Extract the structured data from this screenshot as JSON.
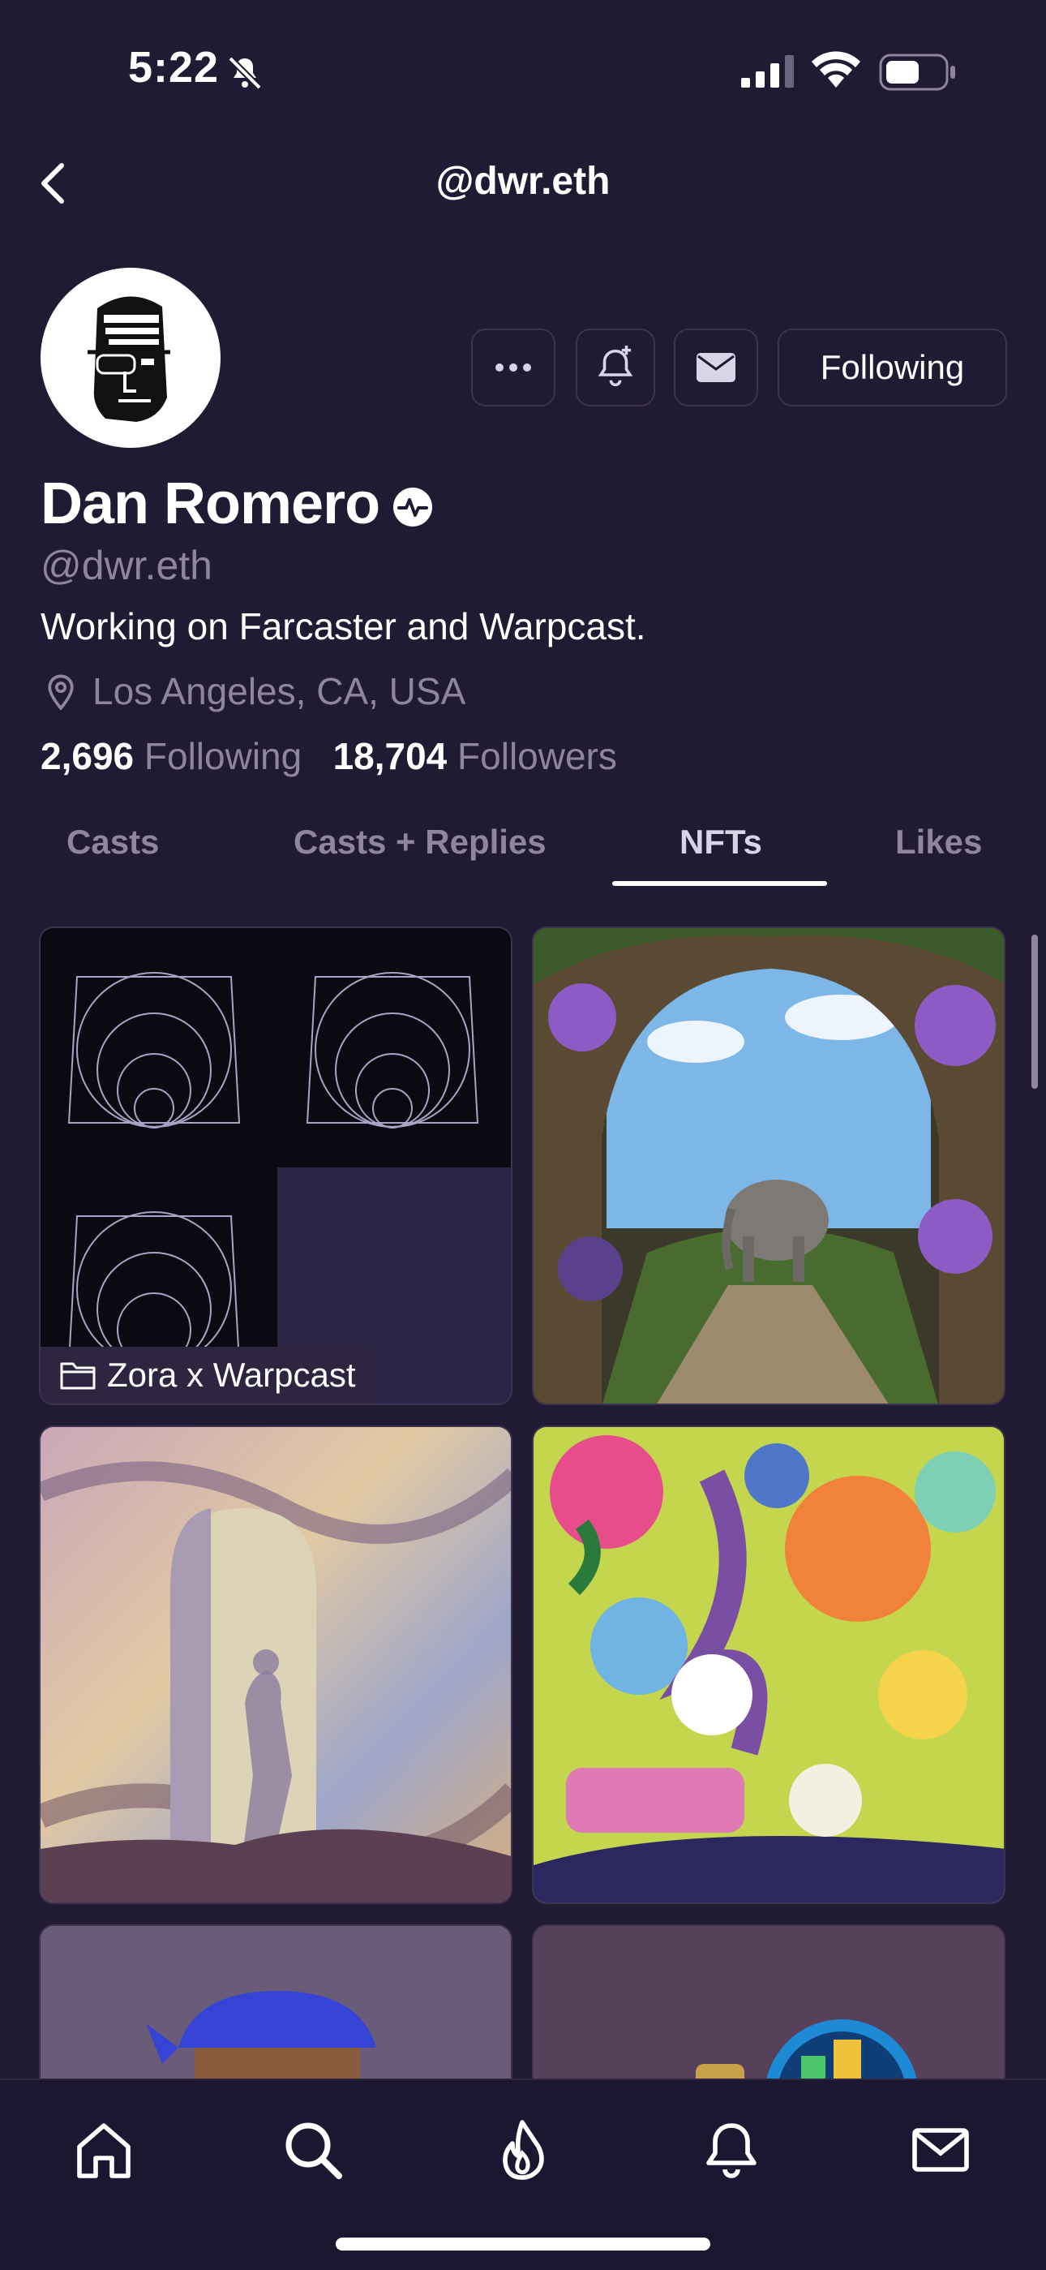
{
  "status_bar": {
    "time": "5:22"
  },
  "nav": {
    "title": "@dwr.eth"
  },
  "profile": {
    "name": "Dan Romero",
    "handle": "@dwr.eth",
    "bio": "Working on Farcaster and Warpcast.",
    "location": "Los Angeles, CA, USA",
    "following_count": "2,696",
    "following_label": "Following",
    "followers_count": "18,704",
    "followers_label": "Followers"
  },
  "actions": {
    "follow_label": "Following"
  },
  "tabs": [
    {
      "label": "Casts"
    },
    {
      "label": "Casts + Replies"
    },
    {
      "label": "NFTs",
      "active": true
    },
    {
      "label": "Likes"
    }
  ],
  "nfts": {
    "collection_label": "Zora x Warpcast"
  },
  "colors": {
    "background": "#211a33",
    "muted_text": "#8d869c",
    "border": "#3b3350"
  }
}
